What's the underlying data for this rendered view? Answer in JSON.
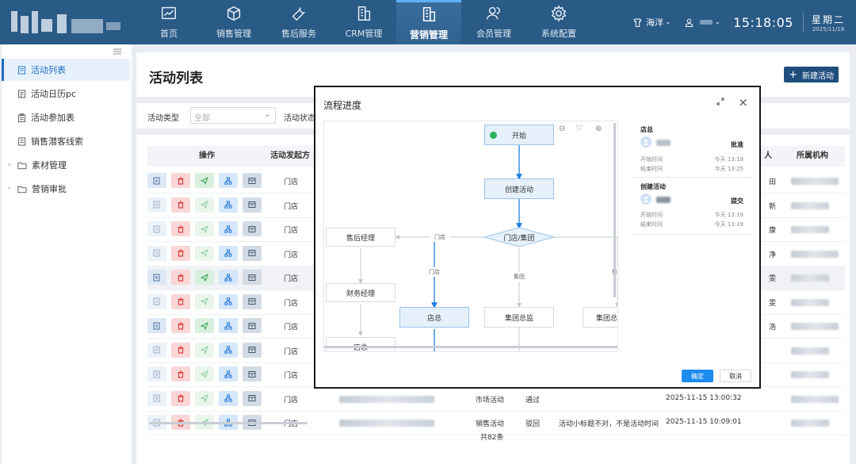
{
  "nav": {
    "items": [
      {
        "label": "首页",
        "icon": "chart-icon"
      },
      {
        "label": "销售管理",
        "icon": "box-icon"
      },
      {
        "label": "售后服务",
        "icon": "wrench-icon"
      },
      {
        "label": "CRM管理",
        "icon": "building-icon"
      },
      {
        "label": "营销管理",
        "icon": "building-icon",
        "active": true
      },
      {
        "label": "会员管理",
        "icon": "users-icon"
      },
      {
        "label": "系统配置",
        "icon": "gear-icon"
      }
    ],
    "user_store": "海洋",
    "time": "15:18:05",
    "weekday": "星期二",
    "date": "2025/11/18"
  },
  "sidebar": {
    "items": [
      {
        "label": "活动列表",
        "active": true
      },
      {
        "label": "活动日历pc"
      },
      {
        "label": "活动参加表"
      },
      {
        "label": "销售潜客线索"
      },
      {
        "label": "素材管理",
        "expandable": true
      },
      {
        "label": "营销审批",
        "expandable": true
      }
    ]
  },
  "page": {
    "title": "活动列表",
    "new_button": "新建活动"
  },
  "filters": {
    "type_label": "活动类型",
    "type_placeholder": "全部",
    "status_label": "活动状态"
  },
  "table": {
    "headers": {
      "ops": "操作",
      "initiator": "活动发起方",
      "person": "人",
      "org": "所属机构"
    },
    "rows": [
      {
        "initiator": "门店",
        "person_partial": "田"
      },
      {
        "initiator": "门店",
        "person_partial": "新"
      },
      {
        "initiator": "门店",
        "person_partial": "康"
      },
      {
        "initiator": "门店",
        "person_partial": "净"
      },
      {
        "initiator": "门店",
        "person_partial": "雯",
        "highlight": true
      },
      {
        "initiator": "门店",
        "person_partial": "雯"
      },
      {
        "initiator": "门店",
        "person_partial": "浩"
      },
      {
        "initiator": "门店",
        "person_partial": ""
      },
      {
        "initiator": "门店",
        "person_partial": ""
      },
      {
        "initiator": "门店",
        "type": "市场活动",
        "status": "通过",
        "remark": "",
        "time": "2025-11-15 13:00:32"
      },
      {
        "initiator": "门店",
        "type": "销售活动",
        "status": "驳回",
        "remark": "活动小标题不对，不是活动时间",
        "time": "2025-11-15 10:09:01"
      }
    ],
    "total": "共82条"
  },
  "modal": {
    "title": "流程进度",
    "nodes": {
      "start": "开始",
      "create": "创建活动",
      "gateway": "门店/集团",
      "after_sales": "售后经理",
      "finance": "财务经理",
      "store_mgr_left": "店总",
      "store_mgr": "店总",
      "group_sup1": "集团总监",
      "group_sup2": "集团总监"
    },
    "edge_labels": {
      "to_after_sales": "门店",
      "to_store": "门店",
      "to_group1": "集团",
      "to_group2": "集团"
    },
    "approvals": [
      {
        "role": "店总",
        "status": "批准",
        "start_label": "开始时间",
        "start": "今天 13:19",
        "end_label": "结束时间",
        "end": "今天 13:25"
      },
      {
        "role": "创建活动",
        "status": "提交",
        "start_label": "开始时间",
        "start": "今天 13:19",
        "end_label": "结束时间",
        "end": "今天 13:19"
      }
    ],
    "ok": "确定",
    "cancel": "取消"
  }
}
